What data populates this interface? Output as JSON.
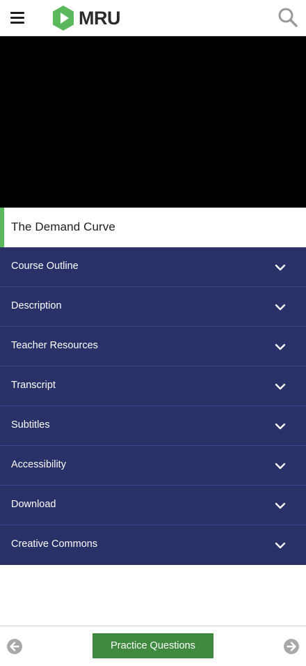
{
  "header": {
    "menu_icon": "hamburger-menu-icon",
    "logo_text": "MRU",
    "logo_icon": "play-hexagon-icon",
    "logo_color": "#5cb85c",
    "search_icon": "search-icon"
  },
  "video": {
    "background": "#000000"
  },
  "lesson": {
    "title": "The Demand Curve",
    "accent_color": "#5cb85c"
  },
  "accordion": {
    "background": "#2a3068",
    "chevron_icon": "chevron-down-icon",
    "items": [
      {
        "label": "Course Outline"
      },
      {
        "label": "Description"
      },
      {
        "label": "Teacher Resources"
      },
      {
        "label": "Transcript"
      },
      {
        "label": "Subtitles"
      },
      {
        "label": "Accessibility"
      },
      {
        "label": "Download"
      },
      {
        "label": "Creative Commons"
      }
    ]
  },
  "bottom_nav": {
    "prev_icon": "arrow-left-circle-icon",
    "next_icon": "arrow-right-circle-icon",
    "practice_label": "Practice Questions",
    "practice_color": "#3f8a3f"
  }
}
